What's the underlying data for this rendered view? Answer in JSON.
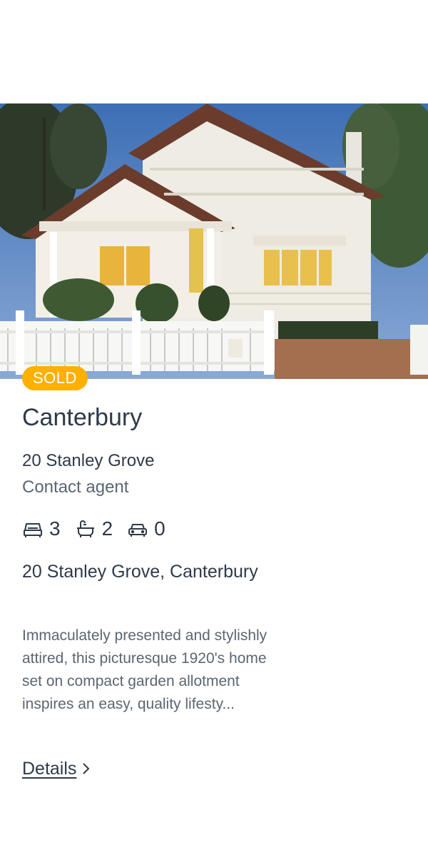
{
  "listing": {
    "status_badge": "SOLD",
    "suburb": "Canterbury",
    "street": "20 Stanley Grove",
    "price": "Contact agent",
    "features": {
      "bedrooms": "3",
      "bathrooms": "2",
      "car_spaces": "0"
    },
    "address": "20 Stanley Grove, Canterbury",
    "description": "Immaculately presented and stylishly attired, this picturesque 1920's home set on compact garden allotment inspires an easy, quality lifesty...",
    "details_link": "Details"
  },
  "icons": {
    "bed": "bed-icon",
    "bath": "bath-icon",
    "car": "car-icon",
    "chevron": "chevron-right-icon"
  },
  "colors": {
    "badge": "#ffb000",
    "text_primary": "#2f3a48",
    "text_secondary": "#5b6672"
  }
}
